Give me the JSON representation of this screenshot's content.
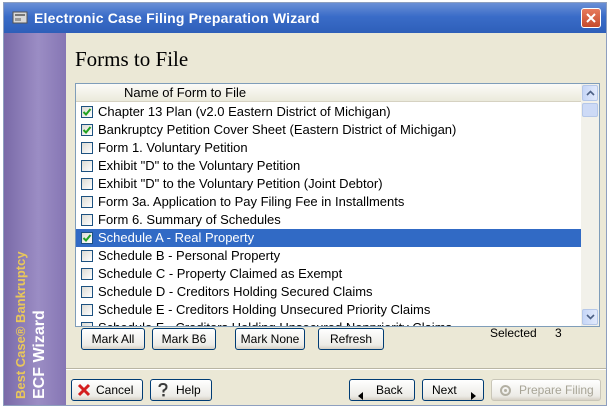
{
  "window": {
    "title": "Electronic Case Filing Preparation Wizard"
  },
  "sidebar": {
    "brand": "Best Case® Bankruptcy",
    "product": "ECF Wizard"
  },
  "page": {
    "title": "Forms to File"
  },
  "forms_list": {
    "column_header": "Name of Form to File",
    "rows": [
      {
        "label": "Chapter 13 Plan (v2.0 Eastern District of Michigan)",
        "checked": true,
        "selected": false
      },
      {
        "label": "Bankruptcy Petition Cover Sheet (Eastern District of Michigan)",
        "checked": true,
        "selected": false
      },
      {
        "label": "Form 1. Voluntary Petition",
        "checked": false,
        "selected": false
      },
      {
        "label": "Exhibit \"D\" to the Voluntary Petition",
        "checked": false,
        "selected": false
      },
      {
        "label": "Exhibit \"D\" to the Voluntary Petition (Joint Debtor)",
        "checked": false,
        "selected": false
      },
      {
        "label": "Form 3a. Application to Pay Filing Fee in Installments",
        "checked": false,
        "selected": false
      },
      {
        "label": "Form 6. Summary of Schedules",
        "checked": false,
        "selected": false
      },
      {
        "label": "Schedule A - Real Property",
        "checked": true,
        "selected": true
      },
      {
        "label": "Schedule B - Personal Property",
        "checked": false,
        "selected": false
      },
      {
        "label": "Schedule C - Property Claimed as Exempt",
        "checked": false,
        "selected": false
      },
      {
        "label": "Schedule D - Creditors Holding Secured Claims",
        "checked": false,
        "selected": false
      },
      {
        "label": "Schedule E - Creditors Holding Unsecured Priority Claims",
        "checked": false,
        "selected": false
      },
      {
        "label": "Schedule F - Creditors Holding Unsecured Nonpriority Claims",
        "checked": false,
        "selected": false
      }
    ]
  },
  "list_buttons": {
    "mark_all": "Mark All",
    "mark_b6": "Mark B6",
    "mark_none": "Mark None",
    "refresh": "Refresh"
  },
  "selection": {
    "label": "Selected",
    "count": "3"
  },
  "footer": {
    "cancel": "Cancel",
    "help": "Help",
    "back": "Back",
    "next": "Next",
    "prepare": "Prepare Filing"
  },
  "colors": {
    "title_bar": "#2e5fb9",
    "selection": "#316ac5",
    "sidebar": "#8676b4",
    "dialog_bg": "#ebe8d6"
  }
}
